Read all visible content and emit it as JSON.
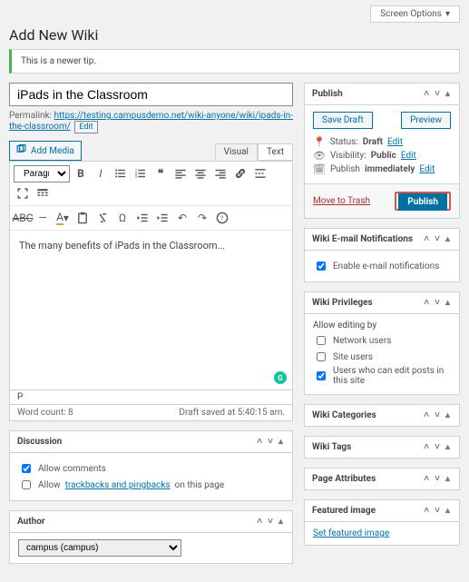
{
  "screen_options": "Screen Options",
  "page_title": "Add New Wiki",
  "tip": "This is a newer tip.",
  "title": "iPads in the Classroom",
  "permalink_label": "Permalink:",
  "permalink_url": "https://testing.campusdemo.net/wiki-anyone/wiki/",
  "permalink_slug": "ipads-in-the-classroom/",
  "edit_btn": "Edit",
  "add_media": "Add Media",
  "tabs": {
    "visual": "Visual",
    "text": "Text"
  },
  "format_sel": "Paragraph",
  "content": "The many benefits of iPads in the Classroom...",
  "path": "P",
  "word_count": "Word count: 8",
  "autosave": "Draft saved at 5:40:15 am.",
  "publish": {
    "title": "Publish",
    "save_draft": "Save Draft",
    "preview": "Preview",
    "status_label": "Status:",
    "status": "Draft",
    "vis_label": "Visibility:",
    "vis": "Public",
    "sched": "Publish",
    "sched2": "immediately",
    "edit": "Edit",
    "trash": "Move to Trash",
    "btn": "Publish"
  },
  "boxes": {
    "email": "Wiki E-mail Notifications",
    "email_opt": "Enable e-mail notifications",
    "priv": "Wiki Privileges",
    "priv_label": "Allow editing by",
    "priv1": "Network users",
    "priv2": "Site users",
    "priv3": "Users who can edit posts in this site",
    "cats": "Wiki Categories",
    "tags": "Wiki Tags",
    "attrs": "Page Attributes",
    "feat": "Featured image",
    "feat_link": "Set featured image"
  },
  "discussion": {
    "title": "Discussion",
    "c1": "Allow comments",
    "c2a": "Allow",
    "c2b": "trackbacks and pingbacks",
    "c2c": "on this page"
  },
  "author": {
    "title": "Author",
    "value": "campus (campus)"
  }
}
